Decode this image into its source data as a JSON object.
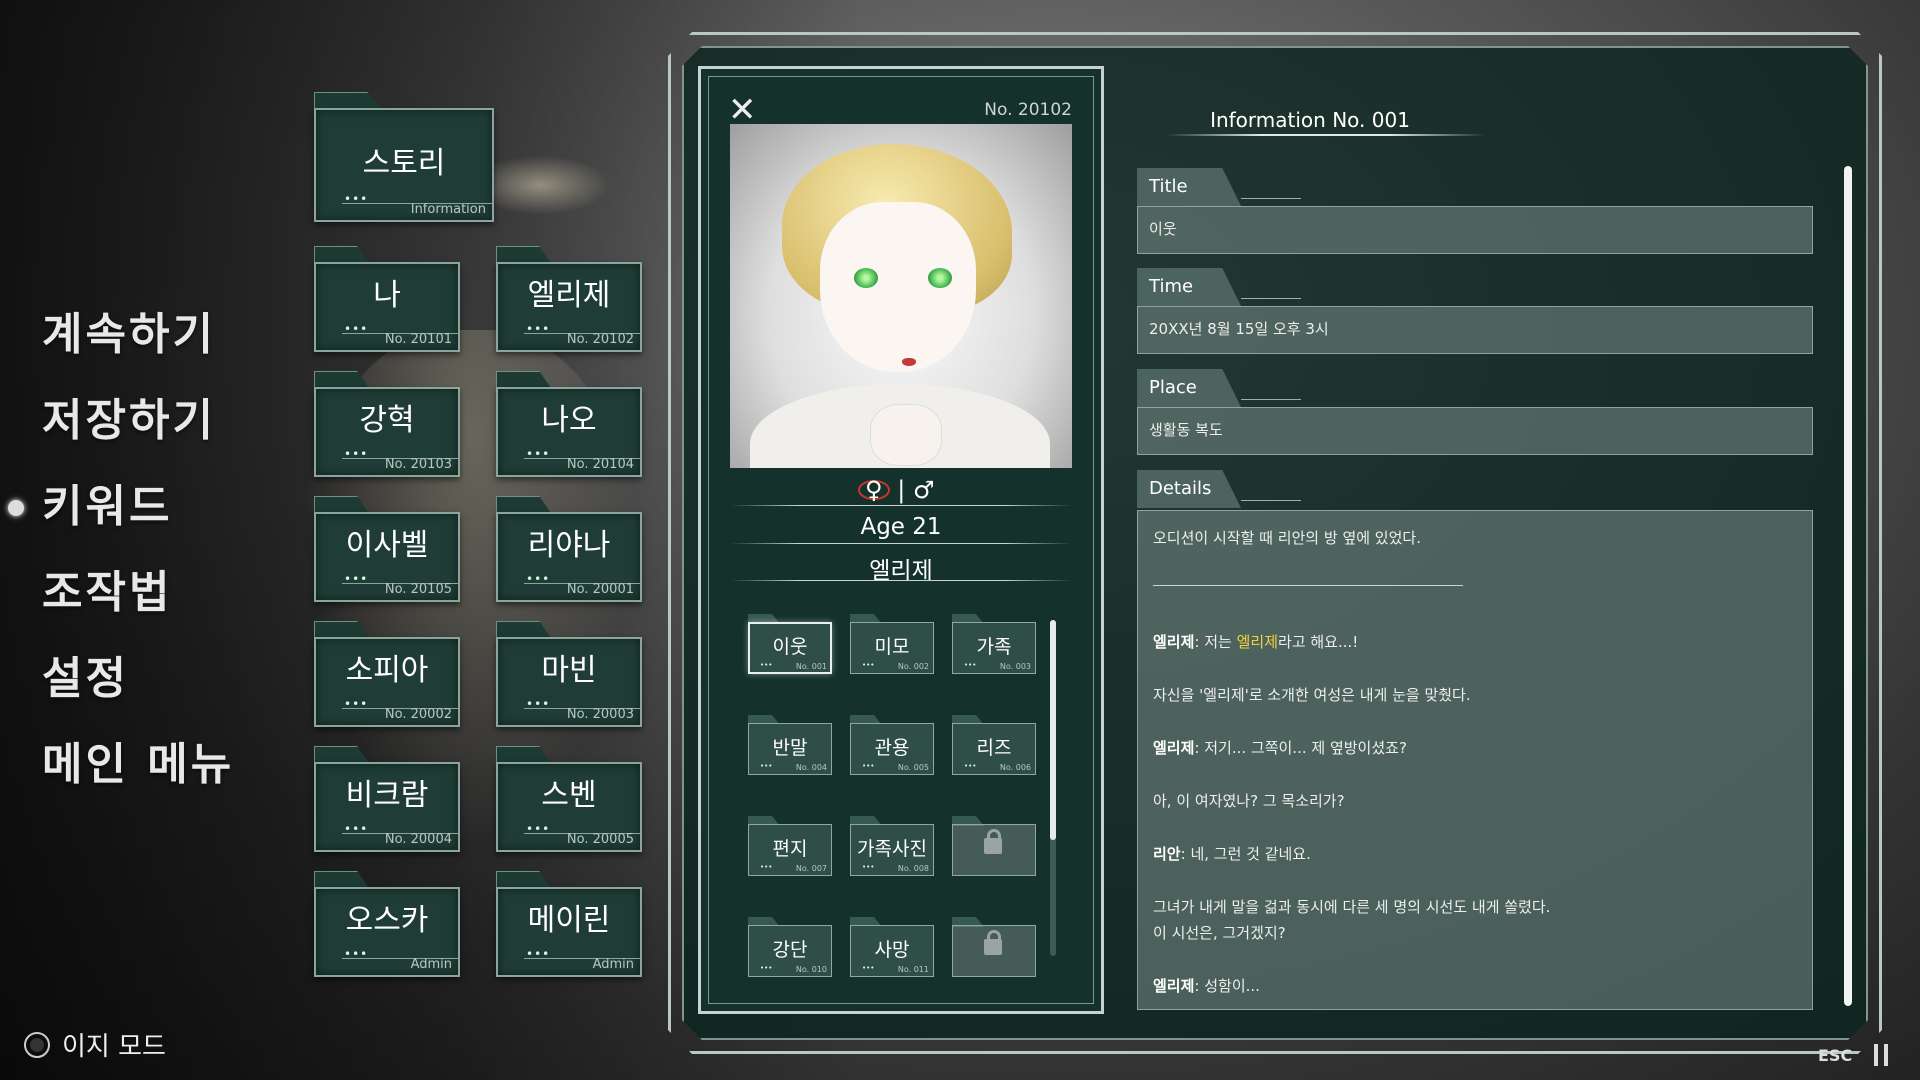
{
  "menu": {
    "items": [
      {
        "label": "계속하기"
      },
      {
        "label": "저장하기"
      },
      {
        "label": "키워드"
      },
      {
        "label": "조작법"
      },
      {
        "label": "설정"
      },
      {
        "label": "메인 메뉴"
      }
    ],
    "active": "키워드",
    "easy_mode_label": "이지 모드"
  },
  "folders": [
    {
      "label": "스토리",
      "number": "Information"
    },
    {
      "label": "나",
      "number": "No. 20101"
    },
    {
      "label": "엘리제",
      "number": "No. 20102"
    },
    {
      "label": "강혁",
      "number": "No. 20103"
    },
    {
      "label": "나오",
      "number": "No. 20104"
    },
    {
      "label": "이사벨",
      "number": "No. 20105"
    },
    {
      "label": "리야나",
      "number": "No. 20001"
    },
    {
      "label": "소피아",
      "number": "No. 20002"
    },
    {
      "label": "마빈",
      "number": "No. 20003"
    },
    {
      "label": "비크람",
      "number": "No. 20004"
    },
    {
      "label": "스벤",
      "number": "No. 20005"
    },
    {
      "label": "오스카",
      "number": "Admin"
    },
    {
      "label": "메이린",
      "number": "Admin"
    }
  ],
  "card": {
    "number": "No. 20102",
    "gender": {
      "female": "♀",
      "separator": "|",
      "male": "♂"
    },
    "age": "Age 21",
    "name": "엘리제",
    "keywords": [
      {
        "label": "이웃",
        "number": "No. 001",
        "selected": true
      },
      {
        "label": "미모",
        "number": "No. 002"
      },
      {
        "label": "가족",
        "number": "No. 003"
      },
      {
        "label": "반말",
        "number": "No. 004"
      },
      {
        "label": "관용",
        "number": "No. 005"
      },
      {
        "label": "리즈",
        "number": "No. 006"
      },
      {
        "label": "편지",
        "number": "No. 007"
      },
      {
        "label": "가족사진",
        "number": "No. 008"
      },
      {
        "label": "",
        "locked": true
      },
      {
        "label": "강단",
        "number": "No. 010"
      },
      {
        "label": "사망",
        "number": "No. 011"
      },
      {
        "label": "",
        "locked": true
      }
    ]
  },
  "info": {
    "header": "Information  No. 001",
    "title_label": "Title",
    "title_value": "이웃",
    "time_label": "Time",
    "time_value": "20XX년 8월 15일 오후 3시",
    "place_label": "Place",
    "place_value": "생활동 복도",
    "details_label": "Details",
    "details_summary": "오디션이 시작할 때 리안의 방 옆에 있었다.",
    "lines": [
      {
        "speaker": "엘리제",
        "sep": ": ",
        "pre": "저는 ",
        "highlight": "엘리제",
        "post": "라고 해요...!"
      },
      {
        "text": "자신을 '엘리제'로 소개한 여성은 내게 눈을 맞췄다."
      },
      {
        "speaker": "엘리제",
        "sep": ": ",
        "post": "저기... 그쪽이... 제 옆방이셨죠?"
      },
      {
        "text": "아, 이 여자였나? 그 목소리가?"
      },
      {
        "speaker": "리안",
        "sep": ": ",
        "post": "네, 그런 것 같네요."
      },
      {
        "text": "그녀가 내게 말을 걺과 동시에 다른 세 명의 시선도 내게 쏠렸다."
      },
      {
        "text": "이 시선은, 그거겠지?"
      },
      {
        "speaker": "엘리제",
        "sep": ": ",
        "post": "성함이..."
      }
    ]
  },
  "footer": {
    "esc_label": "ESC"
  },
  "colors": {
    "panel": "#0c2620",
    "folder": "#1f3d36",
    "highlight": "#f4d03f",
    "accent_red": "#c0392b"
  },
  "icons": [
    "close-icon",
    "lock-icon",
    "pause-icon",
    "radio-icon"
  ]
}
